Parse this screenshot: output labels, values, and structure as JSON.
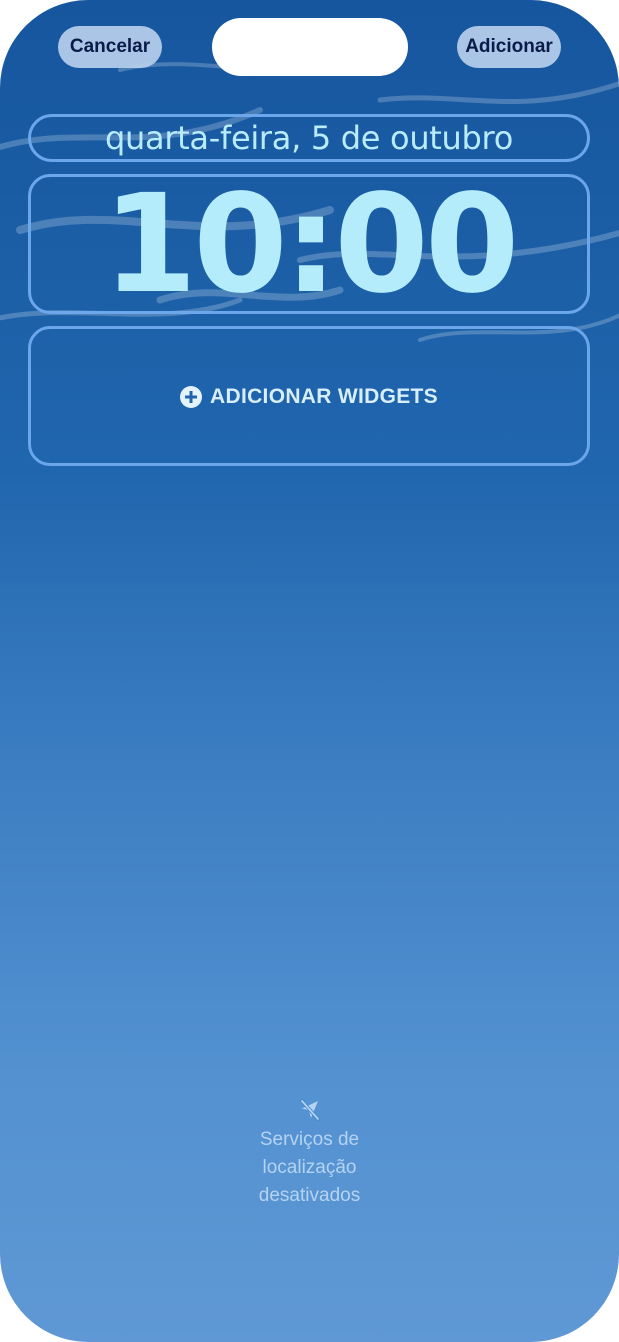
{
  "header": {
    "cancel_label": "Cancelar",
    "add_label": "Adicionar"
  },
  "lock_screen": {
    "date": "quarta-feira, 5 de outubro",
    "time": "10:00",
    "widgets_label": "ADICIONAR WIDGETS"
  },
  "location_notice": {
    "icon": "location-off-icon",
    "lines": [
      "Serviços de",
      "localização",
      "desativados"
    ]
  },
  "colors": {
    "background_top": "#16569e",
    "background_bottom": "#5f98d4",
    "text_accent": "#b4ecfc",
    "frame_border": "#70aaee",
    "button_bg": "#bad1ec",
    "button_text": "#0a1b4a"
  }
}
